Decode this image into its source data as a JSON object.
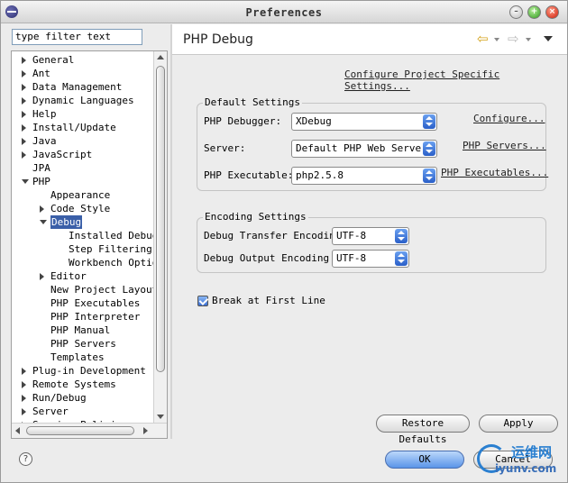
{
  "window": {
    "title": "Preferences",
    "icon": "eclipse-icon",
    "controls": [
      "minimize",
      "maximize",
      "close"
    ]
  },
  "filter": {
    "value": "type filter text"
  },
  "tree": {
    "items": [
      {
        "label": "General",
        "level": 0,
        "state": "collapsed"
      },
      {
        "label": "Ant",
        "level": 0,
        "state": "collapsed"
      },
      {
        "label": "Data Management",
        "level": 0,
        "state": "collapsed"
      },
      {
        "label": "Dynamic Languages",
        "level": 0,
        "state": "collapsed"
      },
      {
        "label": "Help",
        "level": 0,
        "state": "collapsed"
      },
      {
        "label": "Install/Update",
        "level": 0,
        "state": "collapsed"
      },
      {
        "label": "Java",
        "level": 0,
        "state": "collapsed"
      },
      {
        "label": "JavaScript",
        "level": 0,
        "state": "collapsed"
      },
      {
        "label": "JPA",
        "level": 0,
        "state": "leaf"
      },
      {
        "label": "PHP",
        "level": 0,
        "state": "expanded"
      },
      {
        "label": "Appearance",
        "level": 1,
        "state": "leaf"
      },
      {
        "label": "Code Style",
        "level": 1,
        "state": "collapsed"
      },
      {
        "label": "Debug",
        "level": 1,
        "state": "expanded",
        "selected": true
      },
      {
        "label": "Installed Debugg",
        "level": 2,
        "state": "leaf"
      },
      {
        "label": "Step Filtering",
        "level": 2,
        "state": "leaf"
      },
      {
        "label": "Workbench Option",
        "level": 2,
        "state": "leaf"
      },
      {
        "label": "Editor",
        "level": 1,
        "state": "collapsed"
      },
      {
        "label": "New Project Layout",
        "level": 1,
        "state": "leaf"
      },
      {
        "label": "PHP Executables",
        "level": 1,
        "state": "leaf"
      },
      {
        "label": "PHP Interpreter",
        "level": 1,
        "state": "leaf"
      },
      {
        "label": "PHP Manual",
        "level": 1,
        "state": "leaf"
      },
      {
        "label": "PHP Servers",
        "level": 1,
        "state": "leaf"
      },
      {
        "label": "Templates",
        "level": 1,
        "state": "leaf"
      },
      {
        "label": "Plug-in Development",
        "level": 0,
        "state": "collapsed"
      },
      {
        "label": "Remote Systems",
        "level": 0,
        "state": "collapsed"
      },
      {
        "label": "Run/Debug",
        "level": 0,
        "state": "collapsed"
      },
      {
        "label": "Server",
        "level": 0,
        "state": "collapsed"
      },
      {
        "label": "Service Policies",
        "level": 0,
        "state": "collapsed"
      }
    ]
  },
  "page": {
    "title": "PHP Debug",
    "project_link": "Configure Project Specific Settings...",
    "default_settings": {
      "title": "Default Settings",
      "debugger_label": "PHP Debugger:",
      "debugger_value": "XDebug",
      "debugger_link": "Configure...",
      "server_label": "Server:",
      "server_value": "Default PHP Web Server",
      "server_link": "PHP Servers...",
      "executable_label": "PHP Executable:",
      "executable_value": "php2.5.8",
      "executable_link": "PHP Executables..."
    },
    "encoding_settings": {
      "title": "Encoding Settings",
      "transfer_label": "Debug Transfer Encoding",
      "transfer_value": "UTF-8",
      "output_label": "Debug Output Encoding",
      "output_value": "UTF-8"
    },
    "break_first_line": {
      "label": "Break at First Line",
      "checked": true
    },
    "restore_defaults": "Restore Defaults",
    "apply": "Apply"
  },
  "footer": {
    "ok": "OK",
    "cancel": "Cancel"
  },
  "watermark": {
    "text": "运维网",
    "url_text": "iyunv.com"
  }
}
